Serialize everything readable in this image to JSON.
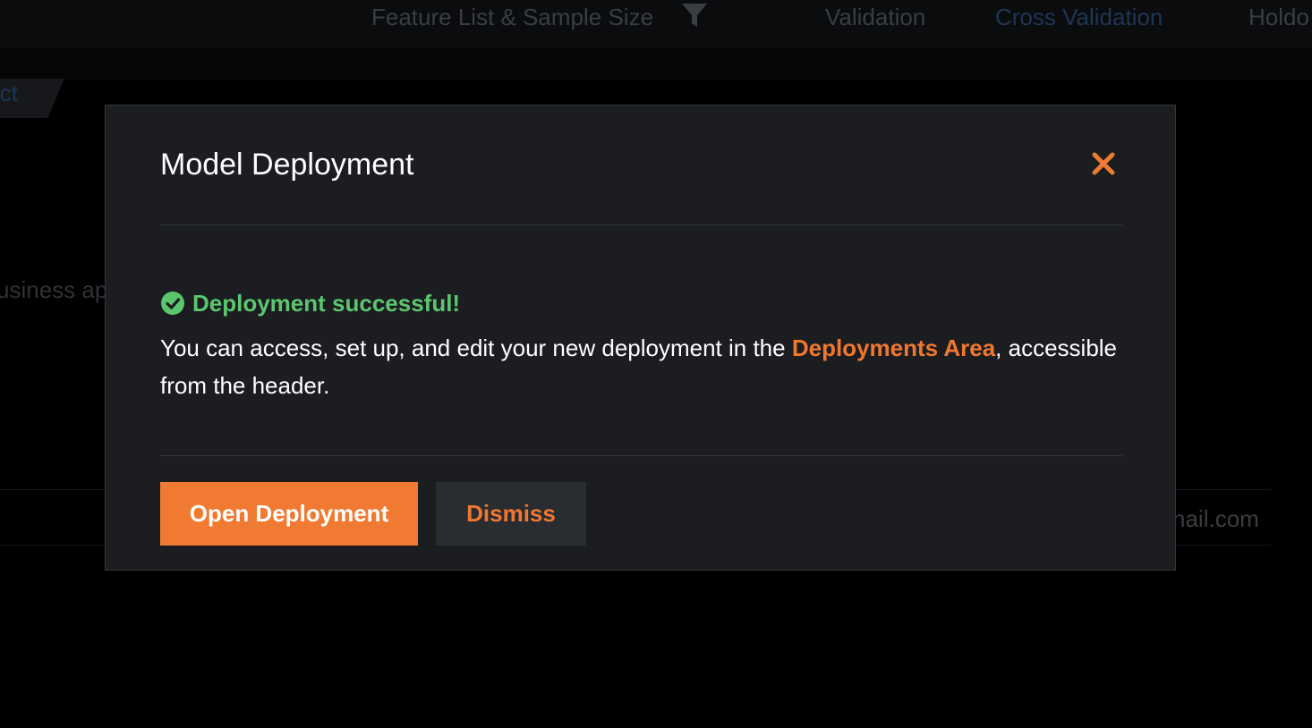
{
  "colors": {
    "accent": "#f07a32",
    "success": "#5cc66f",
    "modal_bg": "#1b1d21"
  },
  "background": {
    "columns": [
      {
        "label": "Feature List & Sample Size",
        "state": "dimmed"
      },
      {
        "label": "Validation",
        "state": "dimmed"
      },
      {
        "label": "Cross Validation",
        "state": "selected"
      },
      {
        "label": "Holdo",
        "state": "dimmed"
      }
    ],
    "filter_icon": "filter-icon",
    "tab_label": "ict",
    "text_fragment": "usiness ap",
    "email_fragment": "nail.com"
  },
  "modal": {
    "title": "Model Deployment",
    "close_icon": "close-icon",
    "success_icon": "check-circle-icon",
    "success_message": "Deployment successful!",
    "body_before_link": "You can access, set up, and edit your new deployment in the ",
    "body_link": "Deployments Area",
    "body_after_link": ", accessible from the header.",
    "primary_button": "Open Deployment",
    "secondary_button": "Dismiss"
  }
}
